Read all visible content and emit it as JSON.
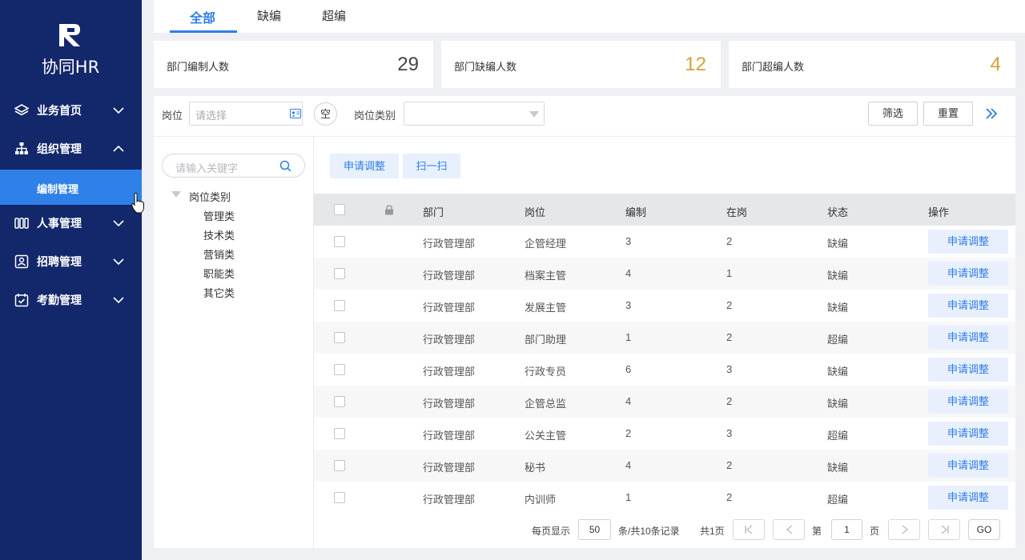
{
  "app": {
    "logo_text": "协同HR"
  },
  "sidebar": {
    "items": [
      {
        "label": "业务首页",
        "icon": "layers-icon"
      },
      {
        "label": "组织管理",
        "icon": "org-chart-icon"
      },
      {
        "label": "人事管理",
        "icon": "people-icon"
      },
      {
        "label": "招聘管理",
        "icon": "recruit-icon"
      },
      {
        "label": "考勤管理",
        "icon": "calendar-check-icon"
      }
    ],
    "sub_item": "编制管理"
  },
  "tabs": [
    "全部",
    "缺编",
    "超编"
  ],
  "stats": [
    {
      "label": "部门编制人数",
      "value": "29",
      "color": "#444444"
    },
    {
      "label": "部门缺编人数",
      "value": "12",
      "color": "#d4a13d"
    },
    {
      "label": "部门超编人数",
      "value": "4",
      "color": "#d4a13d"
    }
  ],
  "filters": {
    "position_label": "岗位",
    "position_placeholder": "请选择",
    "clear_label": "空",
    "category_label": "岗位类别",
    "filter_button": "筛选",
    "reset_button": "重置"
  },
  "tree": {
    "search_placeholder": "请输入关键字",
    "root": "岗位类别",
    "children": [
      "管理类",
      "技术类",
      "营销类",
      "职能类",
      "其它类"
    ]
  },
  "actions": {
    "apply": "申请调整",
    "scan": "扫一扫"
  },
  "table": {
    "headers": [
      "部门",
      "岗位",
      "编制",
      "在岗",
      "状态",
      "操作"
    ],
    "row_action": "申请调整",
    "rows": [
      [
        "行政管理部",
        "企管经理",
        "3",
        "2",
        "缺编"
      ],
      [
        "行政管理部",
        "档案主管",
        "4",
        "1",
        "缺编"
      ],
      [
        "行政管理部",
        "发展主管",
        "3",
        "2",
        "缺编"
      ],
      [
        "行政管理部",
        "部门助理",
        "1",
        "2",
        "超编"
      ],
      [
        "行政管理部",
        "行政专员",
        "6",
        "3",
        "缺编"
      ],
      [
        "行政管理部",
        "企管总监",
        "4",
        "2",
        "缺编"
      ],
      [
        "行政管理部",
        "公关主管",
        "2",
        "3",
        "超编"
      ],
      [
        "行政管理部",
        "秘书",
        "4",
        "2",
        "缺编"
      ],
      [
        "行政管理部",
        "内训师",
        "1",
        "2",
        "超编"
      ]
    ]
  },
  "pager": {
    "per_page_label": "每页显示",
    "per_page": "50",
    "total_label": "条/共10条记录",
    "pages_label": "共1页",
    "page_prefix": "第",
    "page": "1",
    "page_suffix": "页",
    "go": "GO"
  }
}
